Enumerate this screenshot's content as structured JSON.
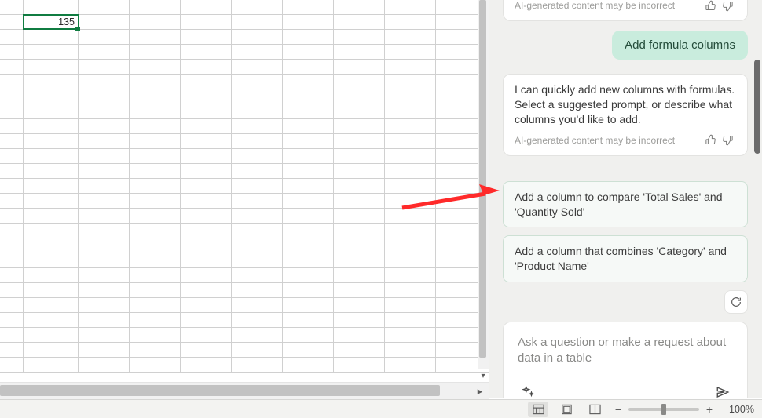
{
  "sheet": {
    "visible_value": "135"
  },
  "chat": {
    "truncated_disclaimer": "AI-generated content may be incorrect",
    "user_message": "Add formula columns",
    "assistant_message": "I can quickly add new columns with formulas. Select a suggested prompt, or describe what columns you'd like to add.",
    "assistant_disclaimer": "AI-generated content may be incorrect",
    "suggestions": [
      "Add a column to compare 'Total Sales' and 'Quantity Sold'",
      "Add a column that combines 'Category' and 'Product Name'"
    ],
    "input_placeholder": "Ask a question or make a request about data in a table"
  },
  "statusbar": {
    "zoom": "100%"
  }
}
